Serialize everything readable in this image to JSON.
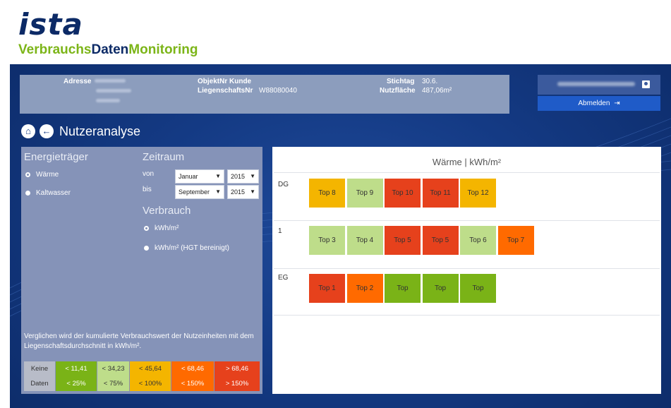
{
  "brand": {
    "logo_main": "ista",
    "logo_sub_1": "Verbrauchs",
    "logo_sub_2": "Daten",
    "logo_sub_3": "Monitoring"
  },
  "info": {
    "adresse_label": "Adresse",
    "objekt_label": "ObjektNr Kunde",
    "liegenschaft_label": "LiegenschaftsNr",
    "liegenschaft_value": "W88080040",
    "stichtag_label": "Stichtag",
    "stichtag_value": "30.6.",
    "nutzflaeche_label": "Nutzfläche",
    "nutzflaeche_value": "487,06m²"
  },
  "user": {
    "logout_label": "Abmelden",
    "icons": {
      "user": "user-icon",
      "logout": "logout-icon"
    }
  },
  "page": {
    "title": "Nutzeranalyse",
    "home_icon": "home-icon",
    "back_icon": "back-arrow-icon"
  },
  "energy": {
    "title": "Energieträger",
    "options": [
      {
        "label": "Wärme",
        "selected": true
      },
      {
        "label": "Kaltwasser",
        "selected": false
      }
    ]
  },
  "period": {
    "title": "Zeitraum",
    "from_label": "von",
    "to_label": "bis",
    "from_month": "Januar",
    "from_year": "2015",
    "to_month": "September",
    "to_year": "2015"
  },
  "consumption": {
    "title": "Verbrauch",
    "options": [
      {
        "label": "kWh/m²",
        "selected": true
      },
      {
        "label": "kWh/m² (HGT bereinigt)",
        "selected": false
      }
    ]
  },
  "note": "Verglichen wird der kumulierte Verbrauchswert der Nutzeinheiten mit dem Liegenschaftsdurchschnitt in kWh/m².",
  "legend": {
    "no_data_1": "Keine",
    "no_data_2": "Daten",
    "values": [
      "< 11,41",
      "< 34,23",
      "< 45,64",
      "< 68,46",
      "> 68,46"
    ],
    "percents": [
      "< 25%",
      "< 75%",
      "< 100%",
      "< 150%",
      "> 150%"
    ],
    "colors": [
      "#7ab317",
      "#bedd8a",
      "#f4b500",
      "#ff6a00",
      "#e6411c"
    ],
    "no_data_color": "#b8bcc8"
  },
  "chart": {
    "title": "Wärme | kWh/m²",
    "floors": [
      {
        "label": "DG",
        "units": [
          {
            "label": "Top 8",
            "color": "#f4b500"
          },
          {
            "label": "Top 9",
            "color": "#bedd8a"
          },
          {
            "label": "Top 10",
            "color": "#e6411c"
          },
          {
            "label": "Top 11",
            "color": "#e6411c"
          },
          {
            "label": "Top 12",
            "color": "#f4b500"
          }
        ]
      },
      {
        "label": "1",
        "units": [
          {
            "label": "Top 3",
            "color": "#bedd8a"
          },
          {
            "label": "Top 4",
            "color": "#bedd8a"
          },
          {
            "label": "Top 5",
            "color": "#e6411c"
          },
          {
            "label": "Top 5",
            "color": "#e6411c"
          },
          {
            "label": "Top 6",
            "color": "#bedd8a"
          },
          {
            "label": "Top 7",
            "color": "#ff6a00"
          }
        ]
      },
      {
        "label": "EG",
        "units": [
          {
            "label": "Top 1",
            "color": "#e6411c"
          },
          {
            "label": "Top 2",
            "color": "#ff6a00"
          },
          {
            "label": "Top",
            "color": "#7ab317"
          },
          {
            "label": "Top",
            "color": "#7ab317"
          },
          {
            "label": "Top",
            "color": "#7ab317"
          }
        ]
      }
    ]
  }
}
